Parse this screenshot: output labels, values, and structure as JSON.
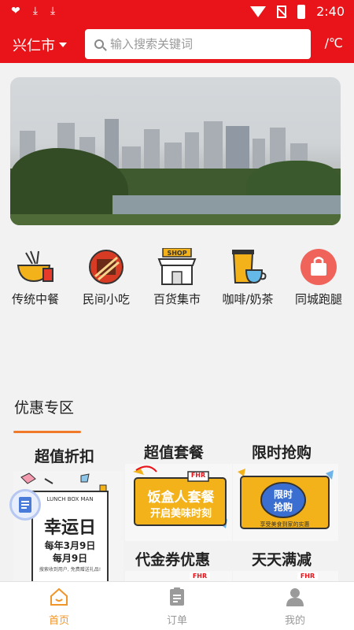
{
  "status_bar": {
    "time": "2:40"
  },
  "header": {
    "city": "兴仁市",
    "search_placeholder": "输入搜索关键词",
    "weather": "/℃"
  },
  "categories": [
    {
      "label": "传统中餐",
      "icon": "noodle-bowl-icon"
    },
    {
      "label": "民间小吃",
      "icon": "skewers-icon"
    },
    {
      "label": "百货集市",
      "icon": "shop-icon"
    },
    {
      "label": "咖啡/奶茶",
      "icon": "coffee-cup-icon"
    },
    {
      "label": "同城跑腿",
      "icon": "shopping-bag-icon"
    }
  ],
  "promo": {
    "title": "优惠专区",
    "cards": [
      {
        "title": "超值折扣",
        "poster_header": "LUNCH BOX MAN",
        "poster_main": "幸运日",
        "poster_line1": "每年3月9日",
        "poster_line2": "每月9日",
        "poster_note": "搜索收到用户, 免费赠送礼品!"
      },
      {
        "title": "超值套餐",
        "tag": "FHR",
        "banner_line1": "饭盒人套餐",
        "banner_line2": "开启美味时刻"
      },
      {
        "title": "限时抢购",
        "badge_line1": "限时",
        "badge_line2": "抢购",
        "note": "享受美食到家的实惠"
      },
      {
        "title": "代金券优惠",
        "tag": "FHR"
      },
      {
        "title": "天天满减",
        "tag": "FHR"
      }
    ]
  },
  "tabs": [
    {
      "label": "首页",
      "icon": "home-icon",
      "active": true
    },
    {
      "label": "订单",
      "icon": "order-icon",
      "active": false
    },
    {
      "label": "我的",
      "icon": "profile-icon",
      "active": false
    }
  ],
  "colors": {
    "brand_red": "#e8141a",
    "accent_orange": "#f07a2a",
    "tab_active": "#f0952a"
  }
}
